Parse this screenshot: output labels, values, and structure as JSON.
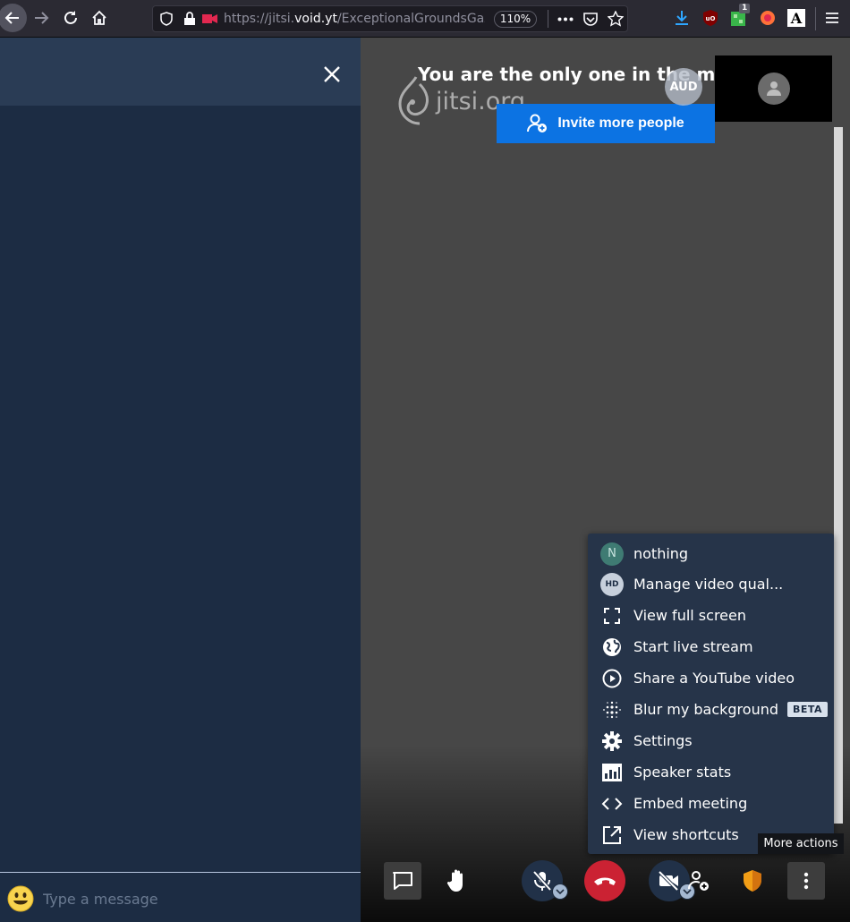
{
  "browser": {
    "url_prefix": "https://jitsi.",
    "url_domain": "void.yt",
    "url_path": "/ExceptionalGroundsGaz",
    "zoom": "110%",
    "extension_badge": "1",
    "extension_a_label": "A"
  },
  "chat": {
    "input_placeholder": "Type a message"
  },
  "stage": {
    "watermark_text": "jitsi.org",
    "only_one_message": "You are the only one in the meeting",
    "invite_button_label": "Invite more people",
    "remote_avatar_initials": "AUD"
  },
  "menu": {
    "items": [
      {
        "label": "nothing",
        "icon": "avatar-n-icon",
        "avatar_letter": "N"
      },
      {
        "label": "Manage video qual...",
        "icon": "hd-icon",
        "avatar_letter": "HD"
      },
      {
        "label": "View full screen",
        "icon": "fullscreen-icon"
      },
      {
        "label": "Start live stream",
        "icon": "globe-icon"
      },
      {
        "label": "Share a YouTube video",
        "icon": "play-circle-icon"
      },
      {
        "label": "Blur my background",
        "icon": "blur-icon",
        "badge": "BETA"
      },
      {
        "label": "Settings",
        "icon": "gear-icon"
      },
      {
        "label": "Speaker stats",
        "icon": "bar-chart-icon"
      },
      {
        "label": "Embed meeting",
        "icon": "code-icon"
      },
      {
        "label": "View shortcuts",
        "icon": "external-link-icon"
      }
    ]
  },
  "toolbar": {
    "more_actions_tooltip": "More actions"
  },
  "colors": {
    "chat_bg": "#1c2c43",
    "stage_bg": "#474747",
    "menu_bg": "#263449",
    "invite_blue": "#0c73e3",
    "hangup_red": "#cb2233",
    "shield_orange": "#f29e16"
  }
}
